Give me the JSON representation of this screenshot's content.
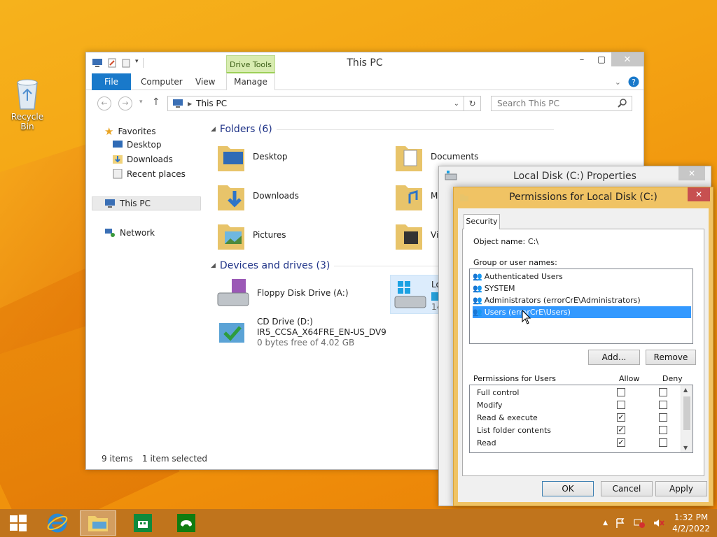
{
  "desktop": {
    "recycle_bin_label": "Recycle Bin"
  },
  "explorer": {
    "title": "This PC",
    "context_tab": "Drive Tools",
    "ribbon_tabs": {
      "file": "File",
      "computer": "Computer",
      "view": "View",
      "manage": "Manage"
    },
    "address": "This PC",
    "search_placeholder": "Search This PC",
    "nav": {
      "favorites": "Favorites",
      "desktop": "Desktop",
      "downloads": "Downloads",
      "recent": "Recent places",
      "this_pc": "This PC",
      "network": "Network"
    },
    "folders_header": "Folders (6)",
    "folders": [
      "Desktop",
      "Documents",
      "Downloads",
      "M",
      "Pictures",
      "Vi"
    ],
    "devices_header": "Devices and drives (3)",
    "floppy": "Floppy Disk Drive (A:)",
    "cd": {
      "name": "CD Drive (D:)",
      "label": "IR5_CCSA_X64FRE_EN-US_DV9",
      "free": "0 bytes free of 4.02 GB"
    },
    "local_disk_partial": {
      "name": "Lo",
      "size": "14"
    },
    "status": {
      "items": "9 items",
      "selected": "1 item selected"
    }
  },
  "properties": {
    "title": "Local Disk (C:) Properties"
  },
  "permissions": {
    "title": "Permissions for Local Disk (C:)",
    "tab": "Security",
    "object_label": "Object name:",
    "object_value": "C:\\",
    "group_label": "Group or user names:",
    "users": [
      "Authenticated Users",
      "SYSTEM",
      "Administrators (errorCrE\\Administrators)",
      "Users (errorCrE\\Users)"
    ],
    "add_button": "Add...",
    "remove_button": "Remove",
    "perms_label": "Permissions for Users",
    "allow_label": "Allow",
    "deny_label": "Deny",
    "perms": [
      {
        "name": "Full control",
        "allow": false,
        "deny": false
      },
      {
        "name": "Modify",
        "allow": false,
        "deny": false
      },
      {
        "name": "Read & execute",
        "allow": true,
        "deny": false
      },
      {
        "name": "List folder contents",
        "allow": true,
        "deny": false
      },
      {
        "name": "Read",
        "allow": true,
        "deny": false
      }
    ],
    "ok": "OK",
    "cancel": "Cancel",
    "apply": "Apply"
  },
  "taskbar": {
    "time": "1:32 PM",
    "date": "4/2/2022"
  },
  "colors": {
    "accent": "#1979ca",
    "selection": "#3399ff",
    "dialog_border": "#f0c364",
    "taskbar": "#c0741c"
  }
}
